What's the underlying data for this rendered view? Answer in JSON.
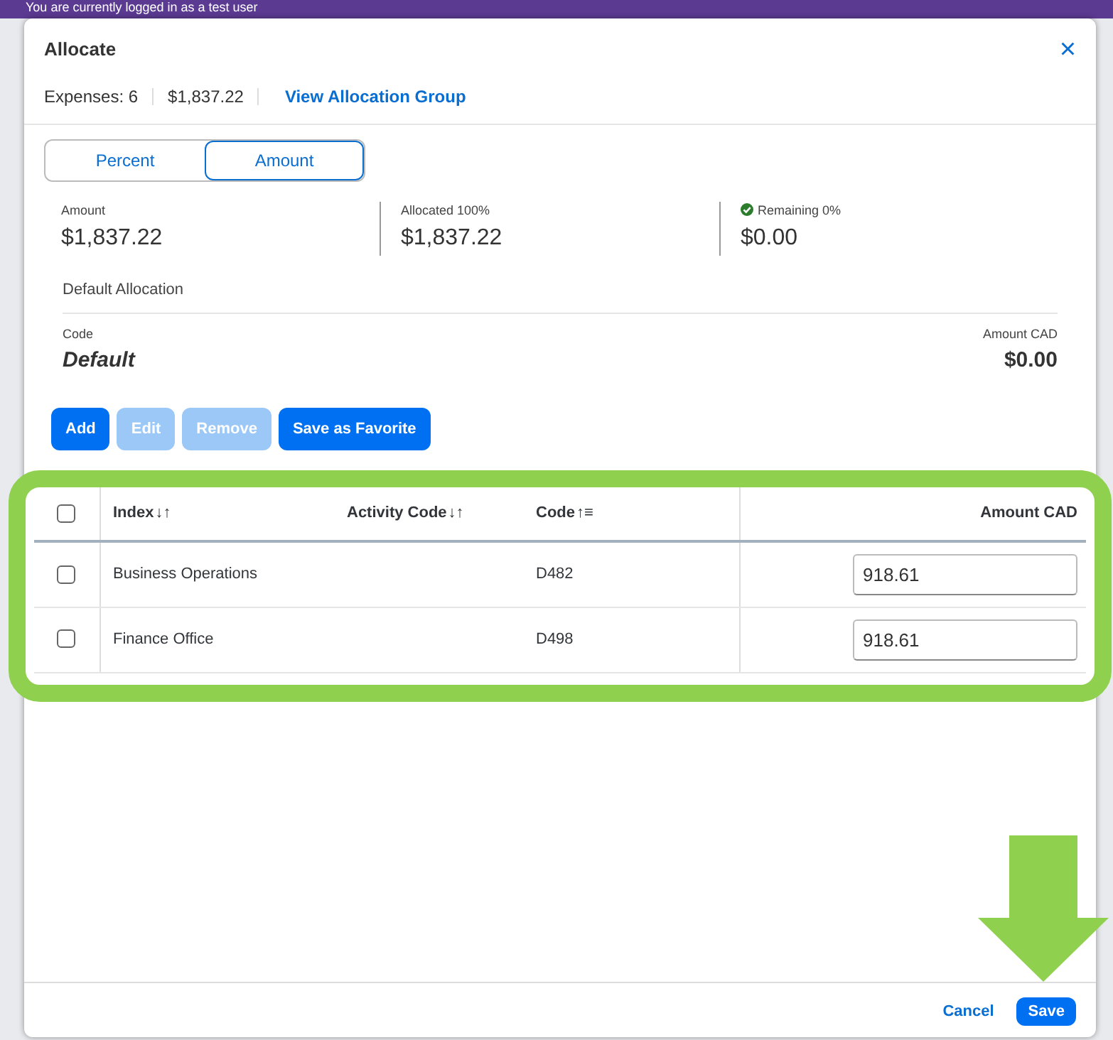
{
  "banner": {
    "text": "You are currently logged in as a test user"
  },
  "dialog": {
    "title": "Allocate",
    "close": "×",
    "summary": {
      "expenses": "Expenses: 6",
      "total": "$1,837.22",
      "link": "View Allocation Group"
    },
    "mode_tabs": [
      {
        "label": "Percent",
        "selected": false
      },
      {
        "label": "Amount",
        "selected": true
      }
    ],
    "stats": [
      {
        "label": "Amount",
        "value": "$1,837.22",
        "ok": false
      },
      {
        "label": "Allocated 100%",
        "value": "$1,837.22",
        "ok": false
      },
      {
        "label": "Remaining 0%",
        "value": "$0.00",
        "ok": true
      }
    ],
    "default_allocation": {
      "heading": "Default Allocation",
      "code_label": "Code",
      "code": "Default",
      "amount_label": "Amount CAD",
      "amount": "$0.00"
    },
    "actions": [
      {
        "label": "Add",
        "disabled": false
      },
      {
        "label": "Edit",
        "disabled": true
      },
      {
        "label": "Remove",
        "disabled": true
      },
      {
        "label": "Save as Favorite",
        "disabled": false
      }
    ],
    "table": {
      "select_all_checked": false,
      "columns": [
        {
          "label": "Index",
          "sort_glyph": "↓↑"
        },
        {
          "label": "Activity Code",
          "sort_glyph": "↓↑"
        },
        {
          "label": "Code",
          "sort_glyph": "↑≡"
        },
        {
          "label": "Amount CAD"
        }
      ],
      "rows": [
        {
          "checked": false,
          "index": "Business Operations",
          "code": "D482",
          "amount": "918.61"
        },
        {
          "checked": false,
          "index": "Finance Office",
          "code": "D498",
          "amount": "918.61"
        }
      ]
    },
    "footer": {
      "buttons": [
        {
          "label": "Cancel",
          "kind": "link"
        },
        {
          "label": "Save",
          "kind": "primary"
        }
      ]
    }
  }
}
